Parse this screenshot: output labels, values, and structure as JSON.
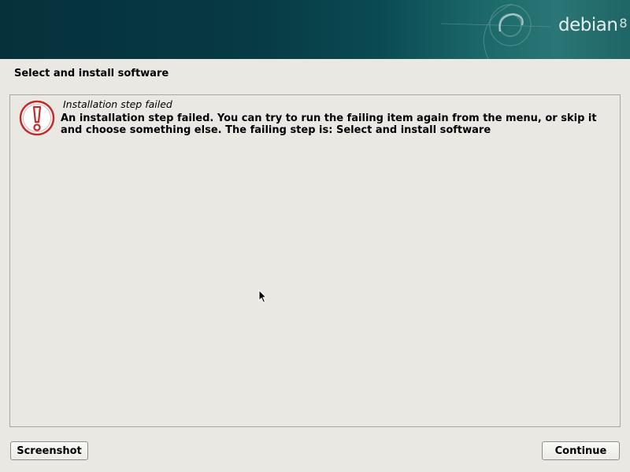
{
  "header": {
    "brand": "debian",
    "version": "8"
  },
  "step": {
    "title": "Select and install software"
  },
  "alert": {
    "icon": "exclamation-icon",
    "heading": "Installation step failed",
    "message": "An installation step failed. You can try to run the failing item again from the menu, or skip it and choose something else. The failing step is: Select and install software"
  },
  "buttons": {
    "screenshot": "Screenshot",
    "continue": "Continue"
  },
  "colors": {
    "background": "#e9e8e2",
    "banner": "#073a44",
    "alert": "#cc2222"
  }
}
